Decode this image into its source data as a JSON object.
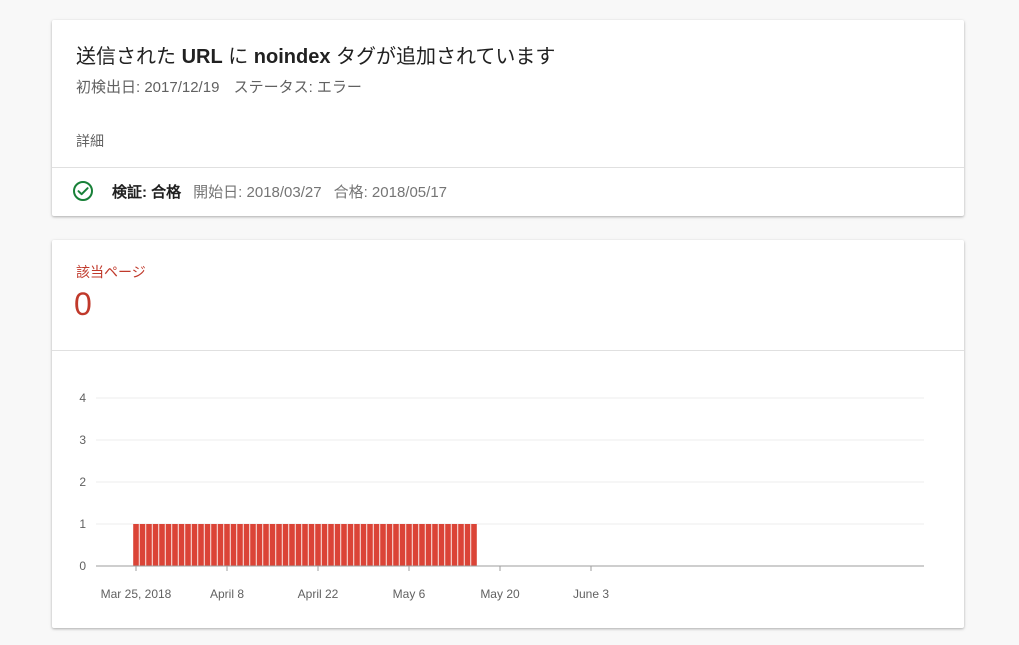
{
  "issue": {
    "title_prefix": "送信された ",
    "title_url": "URL",
    "title_mid": " に ",
    "title_noindex": "noindex",
    "title_suffix": " タグが追加されています",
    "first_detected": "初検出日: 2017/12/19",
    "status": "ステータス: エラー",
    "details_label": "詳細",
    "validation": {
      "label": "検証: 合格",
      "start_date": "開始日: 2018/03/27",
      "passed_date": "合格: 2018/05/17",
      "icon": "check-circle-icon",
      "color": "#188038"
    }
  },
  "metric": {
    "label": "該当ページ",
    "value": "0",
    "color": "#c0392b"
  },
  "chart_data": {
    "type": "bar",
    "x_tick_labels": [
      "Mar 25, 2018",
      "April 8",
      "April 22",
      "May 6",
      "May 20",
      "June 3"
    ],
    "y_tick_labels": [
      "0",
      "1",
      "2",
      "3",
      "4"
    ],
    "ylim": [
      0,
      4
    ],
    "x_start": "2018-03-25",
    "x_end": "2018-06-16",
    "bars": {
      "start": "2018-03-25",
      "end": "2018-05-16",
      "value": 1
    },
    "bar_color": "#db4437",
    "grid": true
  }
}
